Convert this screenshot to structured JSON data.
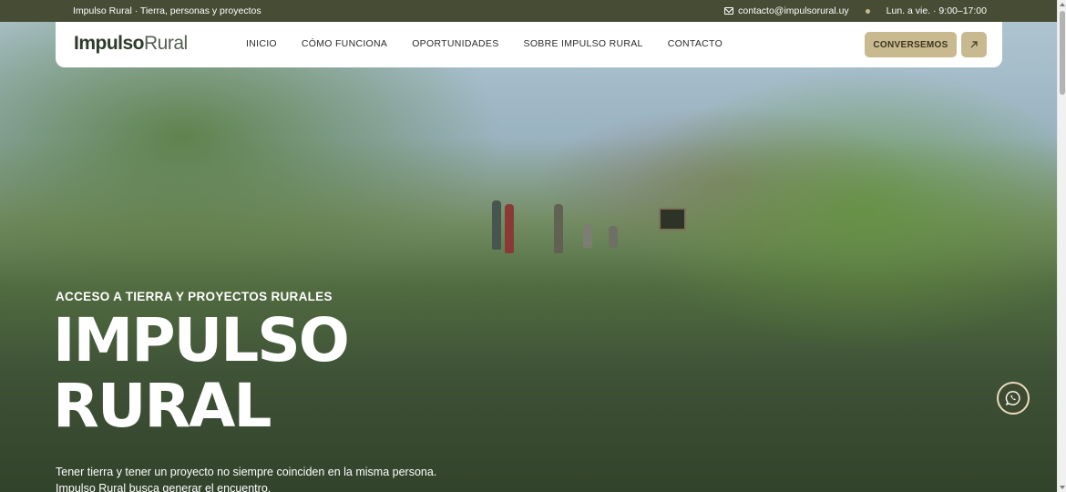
{
  "topbar": {
    "tagline": "Impulso Rural · Tierra, personas y proyectos",
    "email": "contacto@impulsorural.uy",
    "hours": "Lun. a vie. · 9:00–17:00",
    "email_icon": "mail-icon"
  },
  "navbar": {
    "logo_part1": "Impulso",
    "logo_part2": "Rural",
    "items": [
      "INICIO",
      "CÓMO FUNCIONA",
      "OPORTUNIDADES",
      "SOBRE IMPULSO RURAL",
      "CONTACTO"
    ],
    "cta_label": "CONVERSEMOS",
    "cta_icon": "arrow-up-right-icon"
  },
  "hero": {
    "eyebrow": "ACCESO A TIERRA Y PROYECTOS RURALES",
    "title_line1": "IMPULSO",
    "title_line2": "RURAL",
    "description_line1": "Tener tierra y tener un proyecto no siempre coinciden en la misma persona.",
    "description_line2": "Impulso Rural busca generar el encuentro."
  },
  "floating": {
    "whatsapp_icon": "whatsapp-icon"
  },
  "colors": {
    "topbar_bg": "#474d34",
    "accent": "#c9b98f",
    "text_dark": "#2b2b2b",
    "white": "#ffffff"
  }
}
